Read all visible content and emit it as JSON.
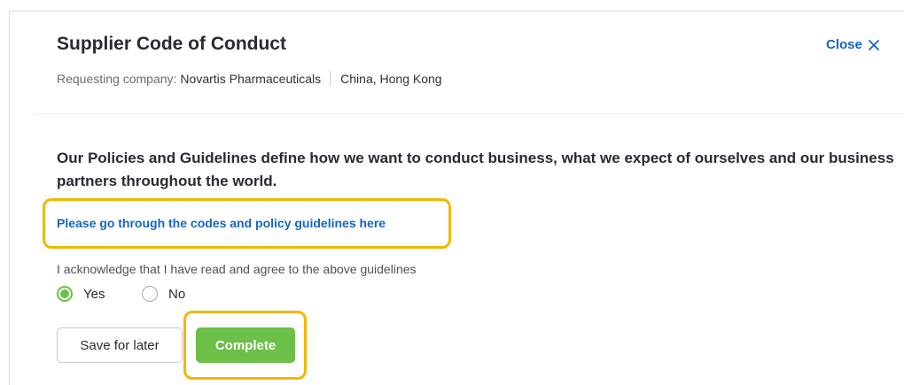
{
  "dialog": {
    "title": "Supplier Code of Conduct",
    "close_label": "Close",
    "close_icon": "close-icon"
  },
  "requester": {
    "label": "Requesting company:",
    "company": "Novartis Pharmaceuticals",
    "region": "China, Hong Kong"
  },
  "content": {
    "intro": "Our Policies and Guidelines define how we want to conduct business, what we expect of ourselves and our business partners throughout the world.",
    "guidelines_link": "Please go through the codes and policy guidelines here"
  },
  "acknowledgement": {
    "question": "I acknowledge that I have read and agree to the above guidelines",
    "options": [
      {
        "label": "Yes",
        "selected": true
      },
      {
        "label": "No",
        "selected": false
      }
    ]
  },
  "actions": {
    "save_label": "Save for later",
    "complete_label": "Complete"
  },
  "colors": {
    "link_blue": "#1565c0",
    "accent_green": "#6cbf47",
    "highlight_yellow": "#f2b705"
  }
}
